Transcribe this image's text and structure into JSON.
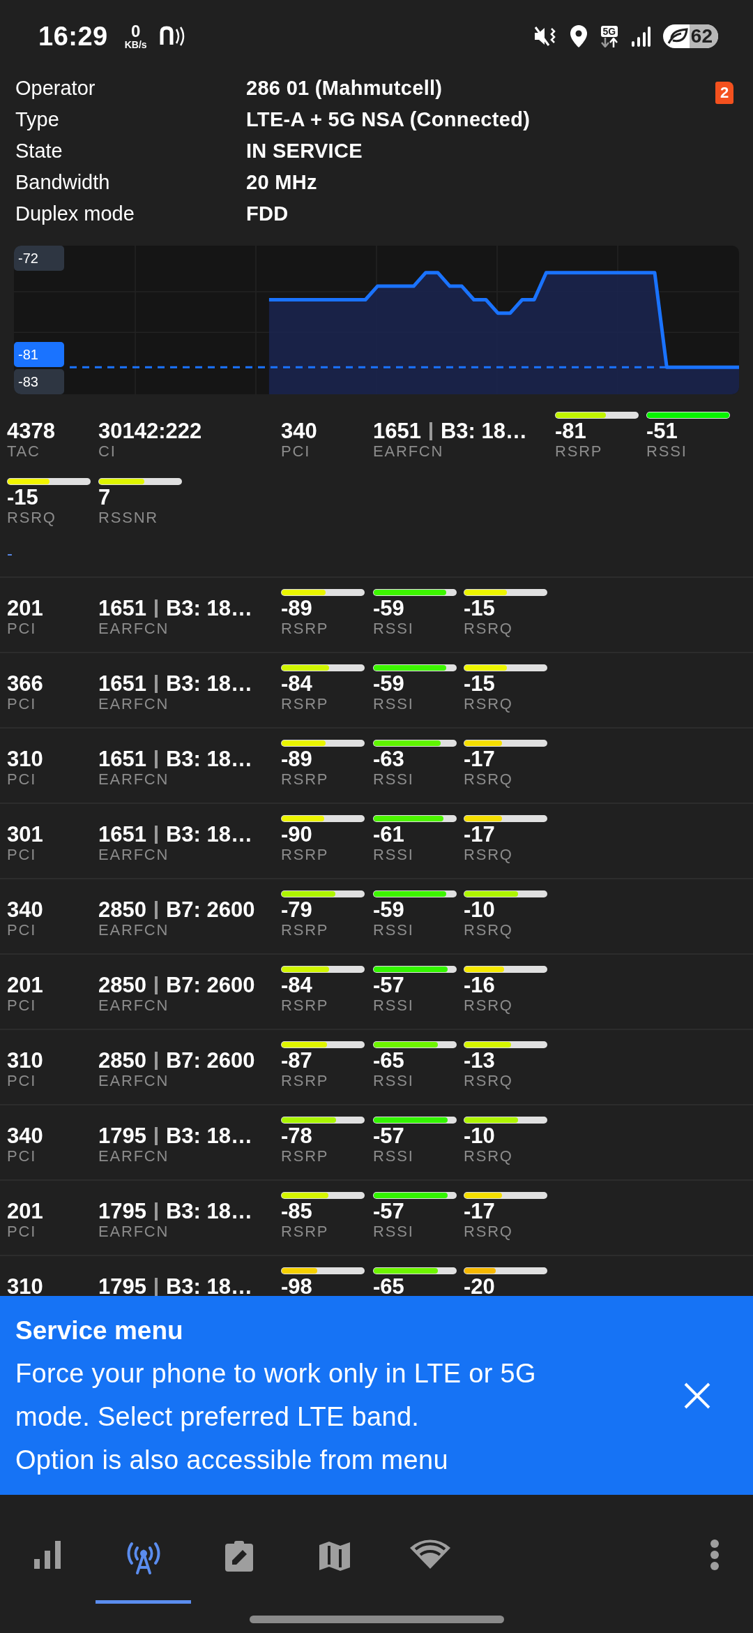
{
  "status_bar": {
    "time": "16:29",
    "net_speed_value": "0",
    "net_speed_unit": "KB/s",
    "network_type": "5G",
    "battery": "62"
  },
  "sim_badge": "2",
  "info": [
    {
      "label": "Operator",
      "value": "286 01 (Mahmutcell)"
    },
    {
      "label": "Type",
      "value": "LTE-A + 5G NSA (Connected)"
    },
    {
      "label": "State",
      "value": "IN SERVICE"
    },
    {
      "label": "Bandwidth",
      "value": "20 MHz"
    },
    {
      "label": "Duplex mode",
      "value": "FDD"
    }
  ],
  "signal_chart": {
    "max_label": "-72",
    "current_label": "-81",
    "min_label": "-83"
  },
  "serving_cell": [
    {
      "label": "TAC",
      "value": "4378"
    },
    {
      "label": "CI",
      "value": "30142:222"
    },
    {
      "label": "PCI",
      "value": "340"
    },
    {
      "label": "EARFCN",
      "value": "1651",
      "band": "B3: 18…"
    },
    {
      "label": "RSRP",
      "value": "-81",
      "level": 0.61
    },
    {
      "label": "RSSI",
      "value": "-51",
      "level": 1.0
    },
    {
      "label": "RSRQ",
      "value": "-15",
      "level": 0.51
    },
    {
      "label": "RSSNR",
      "value": "7",
      "level": 0.55
    }
  ],
  "serving_note": "-",
  "neighbor_cells": [
    {
      "cells": [
        {
          "label": "PCI",
          "value": "201"
        },
        {
          "label": "EARFCN",
          "value": "1651",
          "band": "B3: 18…"
        },
        {
          "label": "RSRP",
          "value": "-89",
          "level": 0.53
        },
        {
          "label": "RSSI",
          "value": "-59",
          "level": 0.88
        },
        {
          "label": "RSRQ",
          "value": "-15",
          "level": 0.52
        }
      ]
    },
    {
      "cells": [
        {
          "label": "PCI",
          "value": "366"
        },
        {
          "label": "EARFCN",
          "value": "1651",
          "band": "B3: 18…"
        },
        {
          "label": "RSRP",
          "value": "-84",
          "level": 0.58
        },
        {
          "label": "RSSI",
          "value": "-59",
          "level": 0.88
        },
        {
          "label": "RSRQ",
          "value": "-15",
          "level": 0.52
        }
      ]
    },
    {
      "cells": [
        {
          "label": "PCI",
          "value": "310"
        },
        {
          "label": "EARFCN",
          "value": "1651",
          "band": "B3: 18…"
        },
        {
          "label": "RSRP",
          "value": "-89",
          "level": 0.53
        },
        {
          "label": "RSSI",
          "value": "-63",
          "level": 0.81
        },
        {
          "label": "RSRQ",
          "value": "-17",
          "level": 0.46
        }
      ]
    },
    {
      "cells": [
        {
          "label": "PCI",
          "value": "301"
        },
        {
          "label": "EARFCN",
          "value": "1651",
          "band": "B3: 18…"
        },
        {
          "label": "RSRP",
          "value": "-90",
          "level": 0.52
        },
        {
          "label": "RSSI",
          "value": "-61",
          "level": 0.85
        },
        {
          "label": "RSRQ",
          "value": "-17",
          "level": 0.46
        }
      ]
    },
    {
      "cells": [
        {
          "label": "PCI",
          "value": "340"
        },
        {
          "label": "EARFCN",
          "value": "2850",
          "band": "B7: 2600"
        },
        {
          "label": "RSRP",
          "value": "-79",
          "level": 0.65
        },
        {
          "label": "RSSI",
          "value": "-59",
          "level": 0.88
        },
        {
          "label": "RSRQ",
          "value": "-10",
          "level": 0.65
        }
      ]
    },
    {
      "cells": [
        {
          "label": "PCI",
          "value": "201"
        },
        {
          "label": "EARFCN",
          "value": "2850",
          "band": "B7: 2600"
        },
        {
          "label": "RSRP",
          "value": "-84",
          "level": 0.58
        },
        {
          "label": "RSSI",
          "value": "-57",
          "level": 0.9
        },
        {
          "label": "RSRQ",
          "value": "-16",
          "level": 0.48
        }
      ]
    },
    {
      "cells": [
        {
          "label": "PCI",
          "value": "310"
        },
        {
          "label": "EARFCN",
          "value": "2850",
          "band": "B7: 2600"
        },
        {
          "label": "RSRP",
          "value": "-87",
          "level": 0.55
        },
        {
          "label": "RSSI",
          "value": "-65",
          "level": 0.78
        },
        {
          "label": "RSRQ",
          "value": "-13",
          "level": 0.57
        }
      ]
    },
    {
      "cells": [
        {
          "label": "PCI",
          "value": "340"
        },
        {
          "label": "EARFCN",
          "value": "1795",
          "band": "B3: 18…"
        },
        {
          "label": "RSRP",
          "value": "-78",
          "level": 0.66
        },
        {
          "label": "RSSI",
          "value": "-57",
          "level": 0.9
        },
        {
          "label": "RSRQ",
          "value": "-10",
          "level": 0.65
        }
      ]
    },
    {
      "cells": [
        {
          "label": "PCI",
          "value": "201"
        },
        {
          "label": "EARFCN",
          "value": "1795",
          "band": "B3: 18…"
        },
        {
          "label": "RSRP",
          "value": "-85",
          "level": 0.57
        },
        {
          "label": "RSSI",
          "value": "-57",
          "level": 0.9
        },
        {
          "label": "RSRQ",
          "value": "-17",
          "level": 0.46
        }
      ]
    },
    {
      "cells": [
        {
          "value": "310"
        },
        {
          "value": "1795",
          "band": "B3: 18…"
        },
        {
          "value": "-98",
          "level": 0.43
        },
        {
          "value": "-65",
          "level": 0.78
        },
        {
          "value": "-20",
          "level": 0.38
        }
      ]
    }
  ],
  "banner": {
    "title": "Service menu",
    "text": "Force your phone to work only in LTE or 5G mode. Select preferred LTE band.\nOption is also accessible from menu"
  },
  "nav_tabs": [
    {
      "selected": false
    },
    {
      "selected": true
    },
    {
      "selected": false
    },
    {
      "selected": false
    },
    {
      "selected": false
    }
  ]
}
